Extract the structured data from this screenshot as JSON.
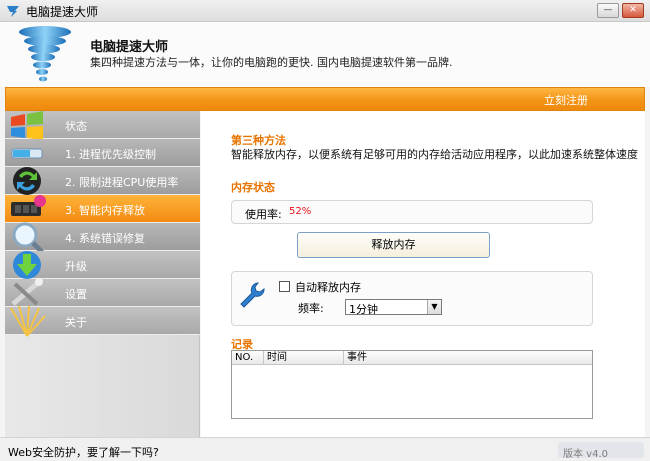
{
  "window": {
    "title": "电脑提速大师",
    "min_glyph": "—",
    "close_glyph": "✕"
  },
  "header": {
    "app_name": "电脑提速大师",
    "slogan": "集四种提速方法与一体，让你的电脑跑的更快. 国内电脑提速软件第一品牌."
  },
  "toolbar": {
    "register_label": "立刻注册"
  },
  "sidebar": {
    "items": [
      {
        "label": "状态",
        "icon": "windows-logo-icon",
        "active": false
      },
      {
        "label": "1. 进程优先级控制",
        "icon": "progress-icon",
        "active": false
      },
      {
        "label": "2. 限制进程CPU使用率",
        "icon": "recycle-arrows-icon",
        "active": false
      },
      {
        "label": "3. 智能内存释放",
        "icon": "memory-chip-icon",
        "active": true
      },
      {
        "label": "4. 系统错误修复",
        "icon": "magnifier-icon",
        "active": false
      },
      {
        "label": "升级",
        "icon": "download-arrow-icon",
        "active": false
      },
      {
        "label": "设置",
        "icon": "tools-icon",
        "active": false
      },
      {
        "label": "关于",
        "icon": "sunburst-icon",
        "active": false
      }
    ]
  },
  "main": {
    "method_title": "第三种方法",
    "method_desc": "智能释放内存，以便系统有足够可用的内存给活动应用程序，以此加速系统整体速度",
    "memory_status_title": "内存状态",
    "usage_label": "使用率:",
    "usage_value": "52%",
    "release_button": "释放内存",
    "auto_release_label": "自动释放内存",
    "auto_release_checked": false,
    "frequency_label": "频率:",
    "frequency_value": "1分钟",
    "log_title": "记录",
    "log_columns": [
      "NO.",
      "时间",
      "事件"
    ],
    "log_rows": []
  },
  "statusbar": {
    "text": "Web安全防护，要了解一下吗?",
    "version": "版本 v4.0"
  },
  "colors": {
    "accent_orange": "#f39417",
    "section_title": "#e87400",
    "usage_value": "#e0141e"
  }
}
